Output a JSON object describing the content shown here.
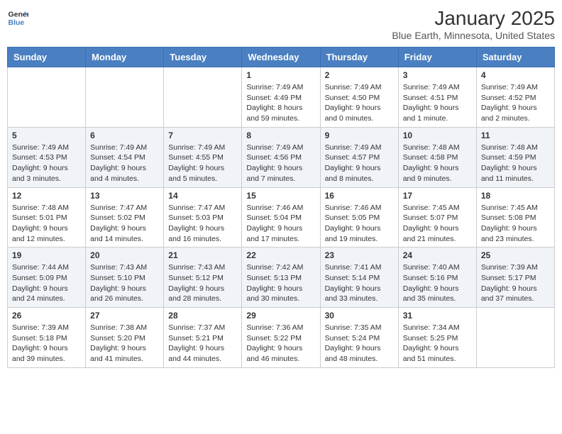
{
  "logo": {
    "general": "General",
    "blue": "Blue"
  },
  "title": "January 2025",
  "subtitle": "Blue Earth, Minnesota, United States",
  "weekdays": [
    "Sunday",
    "Monday",
    "Tuesday",
    "Wednesday",
    "Thursday",
    "Friday",
    "Saturday"
  ],
  "weeks": [
    [
      {
        "day": "",
        "info": ""
      },
      {
        "day": "",
        "info": ""
      },
      {
        "day": "",
        "info": ""
      },
      {
        "day": "1",
        "info": "Sunrise: 7:49 AM\nSunset: 4:49 PM\nDaylight: 8 hours and 59 minutes."
      },
      {
        "day": "2",
        "info": "Sunrise: 7:49 AM\nSunset: 4:50 PM\nDaylight: 9 hours and 0 minutes."
      },
      {
        "day": "3",
        "info": "Sunrise: 7:49 AM\nSunset: 4:51 PM\nDaylight: 9 hours and 1 minute."
      },
      {
        "day": "4",
        "info": "Sunrise: 7:49 AM\nSunset: 4:52 PM\nDaylight: 9 hours and 2 minutes."
      }
    ],
    [
      {
        "day": "5",
        "info": "Sunrise: 7:49 AM\nSunset: 4:53 PM\nDaylight: 9 hours and 3 minutes."
      },
      {
        "day": "6",
        "info": "Sunrise: 7:49 AM\nSunset: 4:54 PM\nDaylight: 9 hours and 4 minutes."
      },
      {
        "day": "7",
        "info": "Sunrise: 7:49 AM\nSunset: 4:55 PM\nDaylight: 9 hours and 5 minutes."
      },
      {
        "day": "8",
        "info": "Sunrise: 7:49 AM\nSunset: 4:56 PM\nDaylight: 9 hours and 7 minutes."
      },
      {
        "day": "9",
        "info": "Sunrise: 7:49 AM\nSunset: 4:57 PM\nDaylight: 9 hours and 8 minutes."
      },
      {
        "day": "10",
        "info": "Sunrise: 7:48 AM\nSunset: 4:58 PM\nDaylight: 9 hours and 9 minutes."
      },
      {
        "day": "11",
        "info": "Sunrise: 7:48 AM\nSunset: 4:59 PM\nDaylight: 9 hours and 11 minutes."
      }
    ],
    [
      {
        "day": "12",
        "info": "Sunrise: 7:48 AM\nSunset: 5:01 PM\nDaylight: 9 hours and 12 minutes."
      },
      {
        "day": "13",
        "info": "Sunrise: 7:47 AM\nSunset: 5:02 PM\nDaylight: 9 hours and 14 minutes."
      },
      {
        "day": "14",
        "info": "Sunrise: 7:47 AM\nSunset: 5:03 PM\nDaylight: 9 hours and 16 minutes."
      },
      {
        "day": "15",
        "info": "Sunrise: 7:46 AM\nSunset: 5:04 PM\nDaylight: 9 hours and 17 minutes."
      },
      {
        "day": "16",
        "info": "Sunrise: 7:46 AM\nSunset: 5:05 PM\nDaylight: 9 hours and 19 minutes."
      },
      {
        "day": "17",
        "info": "Sunrise: 7:45 AM\nSunset: 5:07 PM\nDaylight: 9 hours and 21 minutes."
      },
      {
        "day": "18",
        "info": "Sunrise: 7:45 AM\nSunset: 5:08 PM\nDaylight: 9 hours and 23 minutes."
      }
    ],
    [
      {
        "day": "19",
        "info": "Sunrise: 7:44 AM\nSunset: 5:09 PM\nDaylight: 9 hours and 24 minutes."
      },
      {
        "day": "20",
        "info": "Sunrise: 7:43 AM\nSunset: 5:10 PM\nDaylight: 9 hours and 26 minutes."
      },
      {
        "day": "21",
        "info": "Sunrise: 7:43 AM\nSunset: 5:12 PM\nDaylight: 9 hours and 28 minutes."
      },
      {
        "day": "22",
        "info": "Sunrise: 7:42 AM\nSunset: 5:13 PM\nDaylight: 9 hours and 30 minutes."
      },
      {
        "day": "23",
        "info": "Sunrise: 7:41 AM\nSunset: 5:14 PM\nDaylight: 9 hours and 33 minutes."
      },
      {
        "day": "24",
        "info": "Sunrise: 7:40 AM\nSunset: 5:16 PM\nDaylight: 9 hours and 35 minutes."
      },
      {
        "day": "25",
        "info": "Sunrise: 7:39 AM\nSunset: 5:17 PM\nDaylight: 9 hours and 37 minutes."
      }
    ],
    [
      {
        "day": "26",
        "info": "Sunrise: 7:39 AM\nSunset: 5:18 PM\nDaylight: 9 hours and 39 minutes."
      },
      {
        "day": "27",
        "info": "Sunrise: 7:38 AM\nSunset: 5:20 PM\nDaylight: 9 hours and 41 minutes."
      },
      {
        "day": "28",
        "info": "Sunrise: 7:37 AM\nSunset: 5:21 PM\nDaylight: 9 hours and 44 minutes."
      },
      {
        "day": "29",
        "info": "Sunrise: 7:36 AM\nSunset: 5:22 PM\nDaylight: 9 hours and 46 minutes."
      },
      {
        "day": "30",
        "info": "Sunrise: 7:35 AM\nSunset: 5:24 PM\nDaylight: 9 hours and 48 minutes."
      },
      {
        "day": "31",
        "info": "Sunrise: 7:34 AM\nSunset: 5:25 PM\nDaylight: 9 hours and 51 minutes."
      },
      {
        "day": "",
        "info": ""
      }
    ]
  ]
}
